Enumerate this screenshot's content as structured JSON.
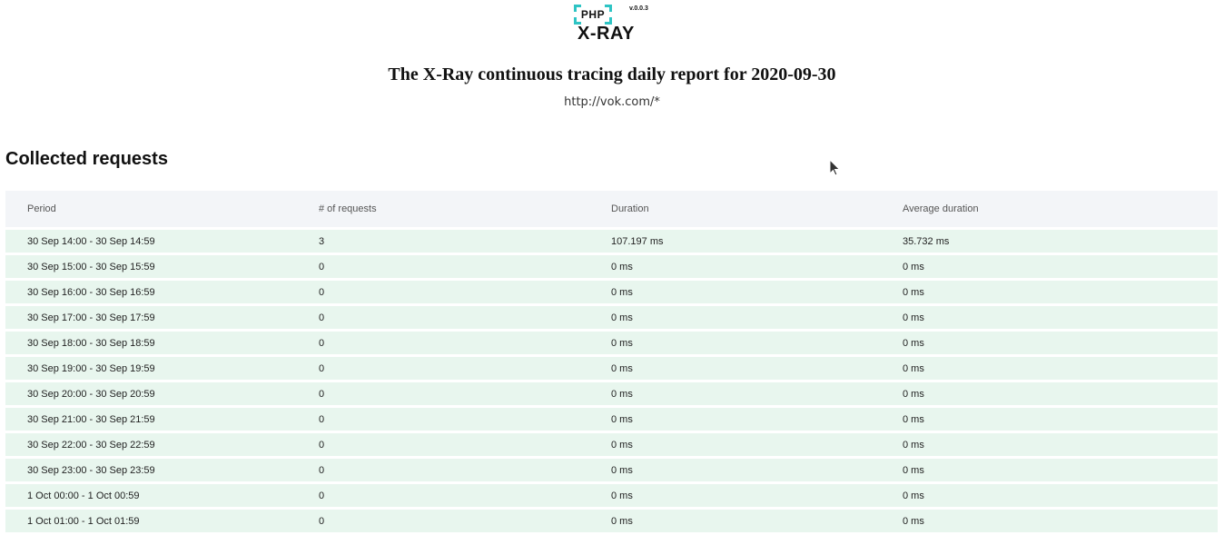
{
  "logo": {
    "php": "PHP",
    "version": "v.0.0.3",
    "name": "X-RAY",
    "accent_color": "#2ec4c4"
  },
  "report": {
    "title": "The X-Ray continuous tracing daily report for 2020-09-30",
    "url": "http://vok.com/*"
  },
  "section": {
    "title": "Collected requests"
  },
  "table": {
    "columns": [
      "Period",
      "# of requests",
      "Duration",
      "Average duration"
    ],
    "rows": [
      [
        "30 Sep 14:00 - 30 Sep 14:59",
        "3",
        "107.197 ms",
        "35.732 ms"
      ],
      [
        "30 Sep 15:00 - 30 Sep 15:59",
        "0",
        "0 ms",
        "0 ms"
      ],
      [
        "30 Sep 16:00 - 30 Sep 16:59",
        "0",
        "0 ms",
        "0 ms"
      ],
      [
        "30 Sep 17:00 - 30 Sep 17:59",
        "0",
        "0 ms",
        "0 ms"
      ],
      [
        "30 Sep 18:00 - 30 Sep 18:59",
        "0",
        "0 ms",
        "0 ms"
      ],
      [
        "30 Sep 19:00 - 30 Sep 19:59",
        "0",
        "0 ms",
        "0 ms"
      ],
      [
        "30 Sep 20:00 - 30 Sep 20:59",
        "0",
        "0 ms",
        "0 ms"
      ],
      [
        "30 Sep 21:00 - 30 Sep 21:59",
        "0",
        "0 ms",
        "0 ms"
      ],
      [
        "30 Sep 22:00 - 30 Sep 22:59",
        "0",
        "0 ms",
        "0 ms"
      ],
      [
        "30 Sep 23:00 - 30 Sep 23:59",
        "0",
        "0 ms",
        "0 ms"
      ],
      [
        "1 Oct 00:00 - 1 Oct 00:59",
        "0",
        "0 ms",
        "0 ms"
      ],
      [
        "1 Oct 01:00 - 1 Oct 01:59",
        "0",
        "0 ms",
        "0 ms"
      ]
    ]
  }
}
